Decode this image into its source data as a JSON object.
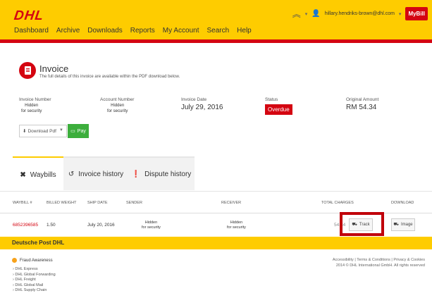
{
  "header": {
    "logo": "DHL",
    "nav": [
      "Dashboard",
      "Archive",
      "Downloads",
      "Reports",
      "My Account",
      "Search",
      "Help"
    ],
    "user_email": "hillary.hendriks-brown@dhl.com",
    "app_badge": "MyBill"
  },
  "invoice": {
    "title": "Invoice",
    "subtitle": "The full details of this invoice are available within the PDF download below.",
    "fields": {
      "invoice_number_label": "Invoice Number",
      "invoice_number_value": "Hidden\nfor security",
      "account_number_label": "Account Number",
      "account_number_value": "Hidden\nfor security",
      "invoice_date_label": "Invoice Date",
      "invoice_date_value": "July 29, 2016",
      "status_label": "Status",
      "status_value": "Overdue",
      "original_amount_label": "Original Amount",
      "original_amount_value": "RM 54.34"
    },
    "download_select": "Download Pdf",
    "pay_label": "Pay"
  },
  "tabs": [
    {
      "label": "Waybills"
    },
    {
      "label": "Invoice history"
    },
    {
      "label": "Dispute history"
    }
  ],
  "table": {
    "headers": [
      "WAYBILL #",
      "BILLED WEIGHT",
      "SHIP DATE",
      "SENDER",
      "RECEIVER",
      "TOTAL CHARGES",
      "DOWNLOAD"
    ],
    "row": {
      "waybill": "6852396585",
      "weight": "1.50",
      "ship_date": "July 20, 2016",
      "sender": "Hidden\nfor security",
      "receiver": "Hidden\nfor security",
      "total": "54.34",
      "track_label": "Track",
      "image_label": "Image"
    }
  },
  "footer": {
    "brand": "Deutsche Post DHL",
    "fraud": "Fraud Awareness",
    "links": [
      "DHL Express",
      "DHL Global Forwarding",
      "DHL Freight",
      "DHL Global Mail",
      "DHL Supply Chain"
    ],
    "legal_links": "Accessibility | Terms & Conditions | Privacy & Cookies",
    "copyright": "2014 © DHL International GmbH. All rights reserved"
  },
  "colors": {
    "yellow": "#fecc00",
    "red": "#d40511",
    "green": "#3cae3c"
  }
}
